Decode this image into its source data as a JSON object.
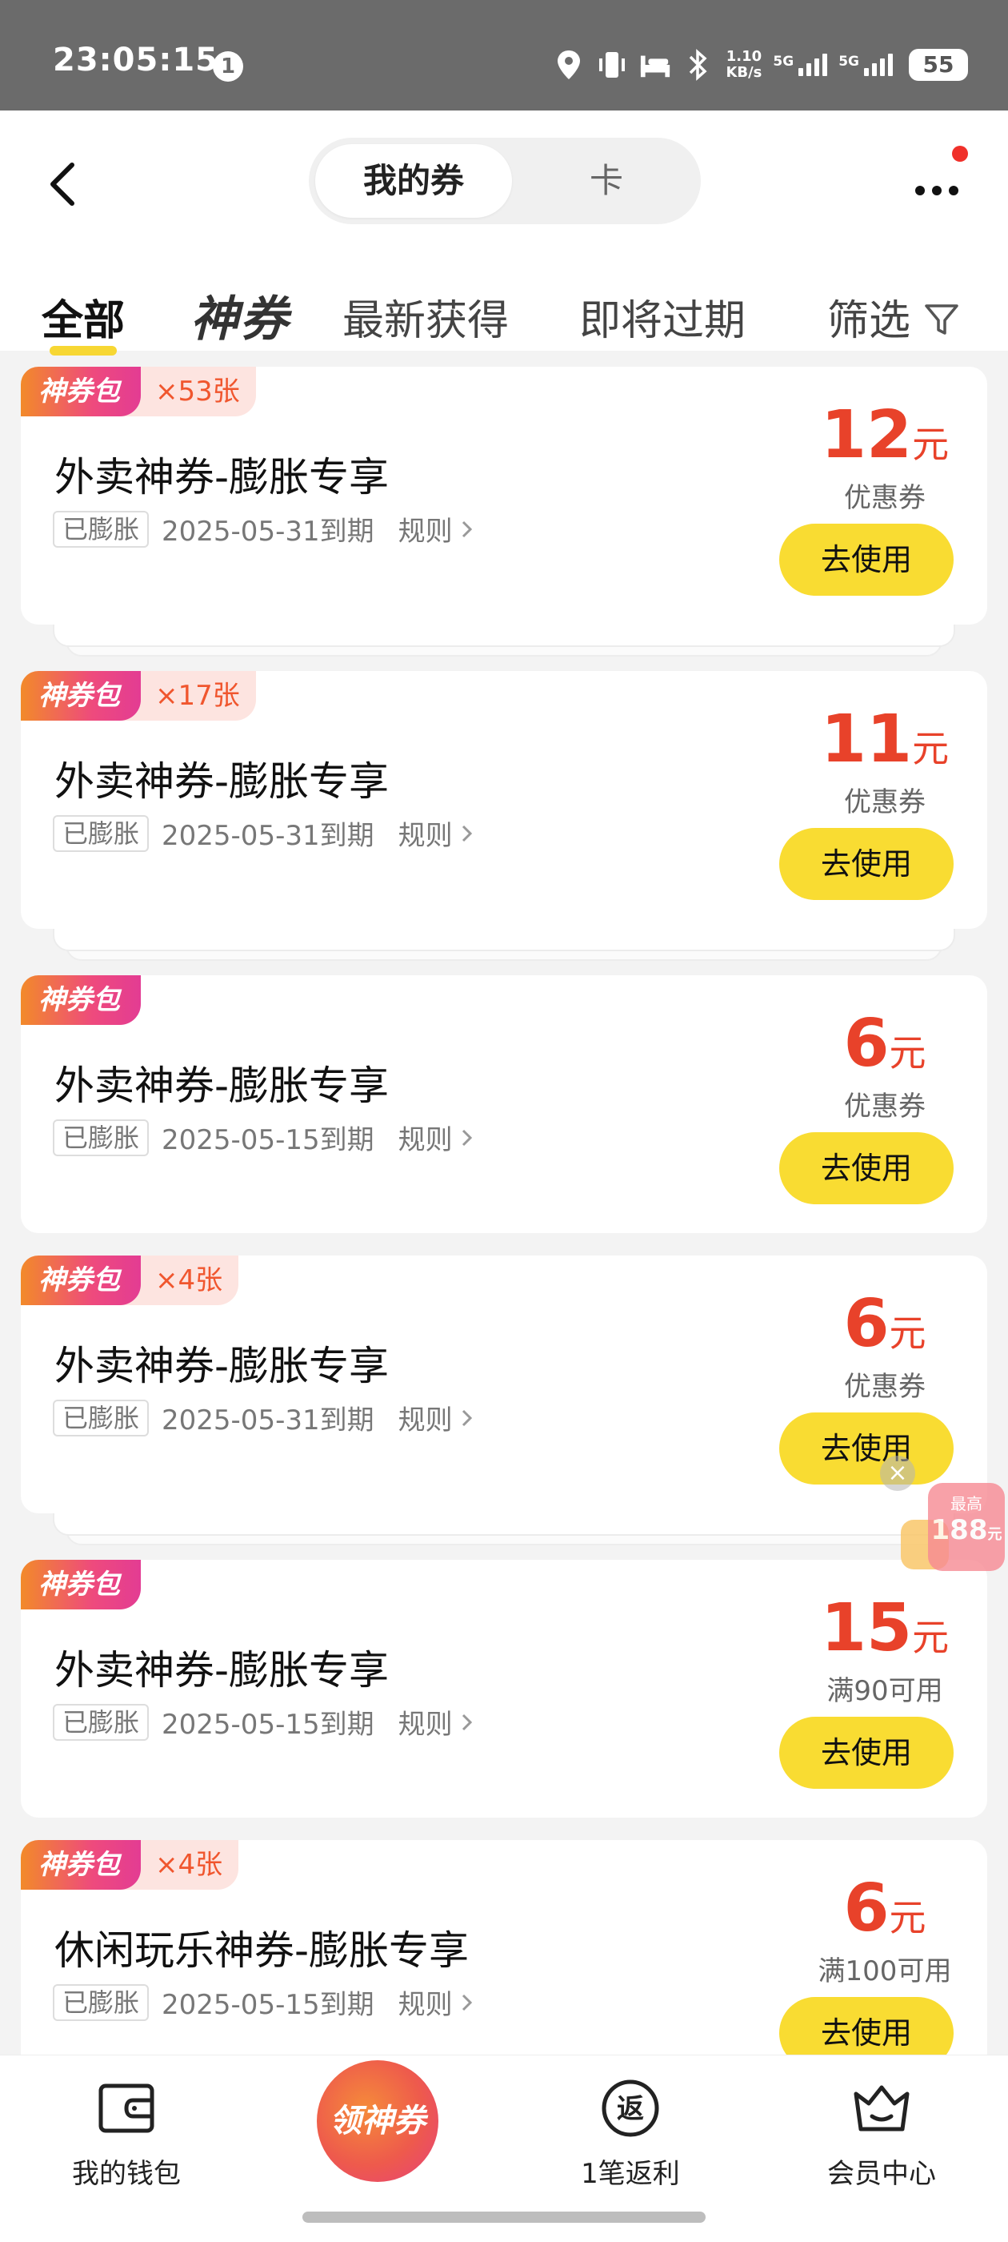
{
  "status_bar": {
    "time": "23:05:15",
    "notification_count": "1",
    "net_speed": "1.10",
    "net_speed_unit": "KB/s",
    "sim1": "5G",
    "sim2": "5G",
    "battery": "55"
  },
  "header": {
    "seg_active": "我的券",
    "seg_inactive": "卡"
  },
  "tabs": {
    "all": "全部",
    "shen": "神券",
    "newest": "最新获得",
    "expiring": "即将过期",
    "filter": "筛选"
  },
  "coupons": [
    {
      "tag": "神券包",
      "count": "×53张",
      "title": "外卖神券-膨胀专享",
      "badge": "已膨胀",
      "expiry": "2025-05-31到期",
      "rules": "规则",
      "amount": "12",
      "unit": "元",
      "condition": "优惠券",
      "button": "去使用"
    },
    {
      "tag": "神券包",
      "count": "×17张",
      "title": "外卖神券-膨胀专享",
      "badge": "已膨胀",
      "expiry": "2025-05-31到期",
      "rules": "规则",
      "amount": "11",
      "unit": "元",
      "condition": "优惠券",
      "button": "去使用"
    },
    {
      "tag": "神券包",
      "count": "",
      "title": "外卖神券-膨胀专享",
      "badge": "已膨胀",
      "expiry": "2025-05-15到期",
      "rules": "规则",
      "amount": "6",
      "unit": "元",
      "condition": "优惠券",
      "button": "去使用"
    },
    {
      "tag": "神券包",
      "count": "×4张",
      "title": "外卖神券-膨胀专享",
      "badge": "已膨胀",
      "expiry": "2025-05-31到期",
      "rules": "规则",
      "amount": "6",
      "unit": "元",
      "condition": "优惠券",
      "button": "去使用"
    },
    {
      "tag": "神券包",
      "count": "",
      "title": "外卖神券-膨胀专享",
      "badge": "已膨胀",
      "expiry": "2025-05-15到期",
      "rules": "规则",
      "amount": "15",
      "unit": "元",
      "condition": "满90可用",
      "button": "去使用"
    },
    {
      "tag": "神券包",
      "count": "×4张",
      "title": "休闲玩乐神券-膨胀专享",
      "badge": "已膨胀",
      "expiry": "2025-05-15到期",
      "rules": "规则",
      "amount": "6",
      "unit": "元",
      "condition": "满100可用",
      "button": "去使用"
    }
  ],
  "float_ad": {
    "top": "最高",
    "amount": "188",
    "unit": "元",
    "close": "×"
  },
  "bottom_nav": {
    "wallet": "我的钱包",
    "center": "领神券",
    "rebate": "1笔返利",
    "rebate_icon_text": "返",
    "member": "会员中心"
  },
  "colors": {
    "accent_yellow": "#f9dc32",
    "price_red": "#e8422a",
    "tag_gradient_start": "#f28a2a",
    "tag_gradient_end": "#e33c93"
  }
}
